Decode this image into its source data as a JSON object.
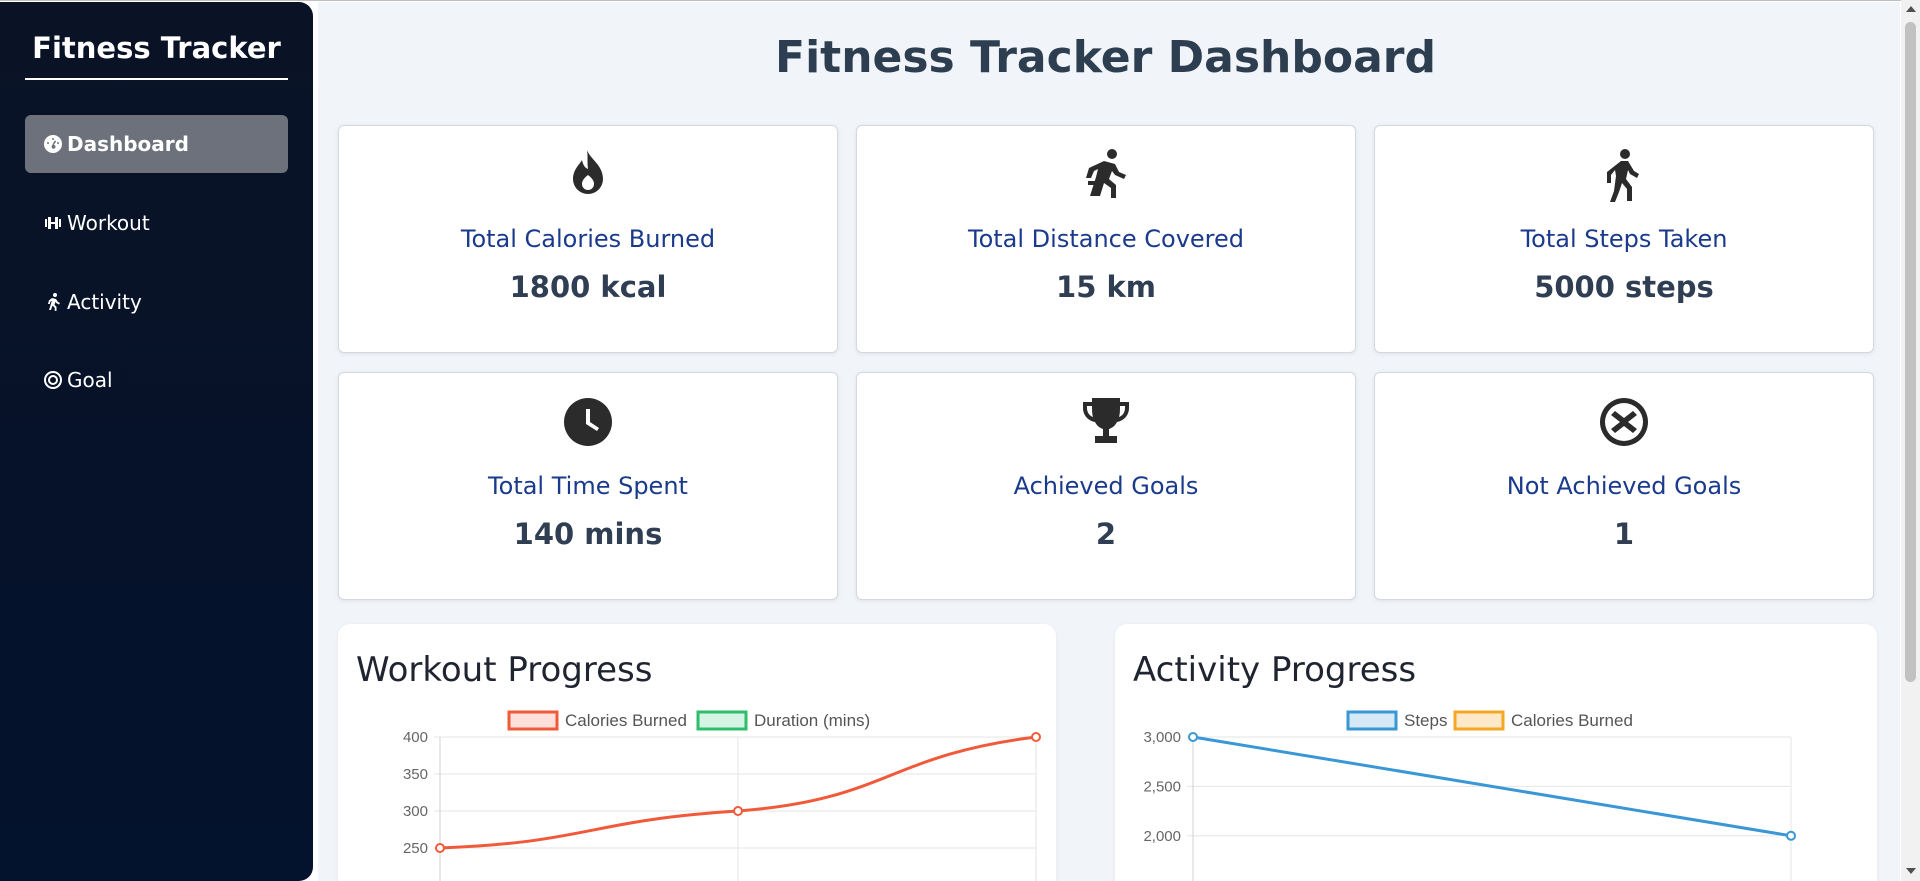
{
  "sidebar": {
    "brand": "Fitness Tracker",
    "items": [
      {
        "label": "Dashboard",
        "icon": "gauge-icon",
        "active": true
      },
      {
        "label": "Workout",
        "icon": "dumbbell-icon",
        "active": false
      },
      {
        "label": "Activity",
        "icon": "running-icon",
        "active": false
      },
      {
        "label": "Goal",
        "icon": "target-icon",
        "active": false
      }
    ]
  },
  "main": {
    "title": "Fitness Tracker Dashboard",
    "cards": [
      {
        "icon": "fire-icon",
        "label": "Total Calories Burned",
        "value": "1800 kcal"
      },
      {
        "icon": "running-icon",
        "label": "Total Distance Covered",
        "value": "15 km"
      },
      {
        "icon": "walking-icon",
        "label": "Total Steps Taken",
        "value": "5000 steps"
      },
      {
        "icon": "clock-icon",
        "label": "Total Time Spent",
        "value": "140 mins"
      },
      {
        "icon": "trophy-icon",
        "label": "Achieved Goals",
        "value": "2"
      },
      {
        "icon": "circle-x-icon",
        "label": "Not Achieved Goals",
        "value": "1"
      }
    ],
    "panels": {
      "workout_title": "Workout Progress",
      "activity_title": "Activity Progress"
    }
  },
  "colors": {
    "sidebar_bg": "#03122d",
    "active_nav": "#6c717c",
    "card_label": "#1a3a8c",
    "calories_line": "#f05a3a",
    "duration_line": "#2ebd6b",
    "steps_line": "#3a97d6",
    "activity_calories": "#f5a623"
  },
  "chart_data": [
    {
      "type": "line",
      "title": "Workout Progress",
      "series": [
        {
          "name": "Calories Burned",
          "values": [
            250,
            300,
            400
          ]
        },
        {
          "name": "Duration (mins)",
          "values": []
        }
      ],
      "x": [
        0,
        1,
        2
      ],
      "yticks": [
        400,
        350,
        300,
        250
      ],
      "ylim": [
        200,
        400
      ],
      "grid": true,
      "legend": "top"
    },
    {
      "type": "line",
      "title": "Activity Progress",
      "series": [
        {
          "name": "Steps",
          "values": [
            3000,
            2000
          ]
        },
        {
          "name": "Calories Burned",
          "values": []
        }
      ],
      "x": [
        0,
        1
      ],
      "yticks": [
        "3,000",
        "2,500",
        "2,000"
      ],
      "ylim": [
        1500,
        3000
      ],
      "grid": true,
      "legend": "top"
    }
  ]
}
